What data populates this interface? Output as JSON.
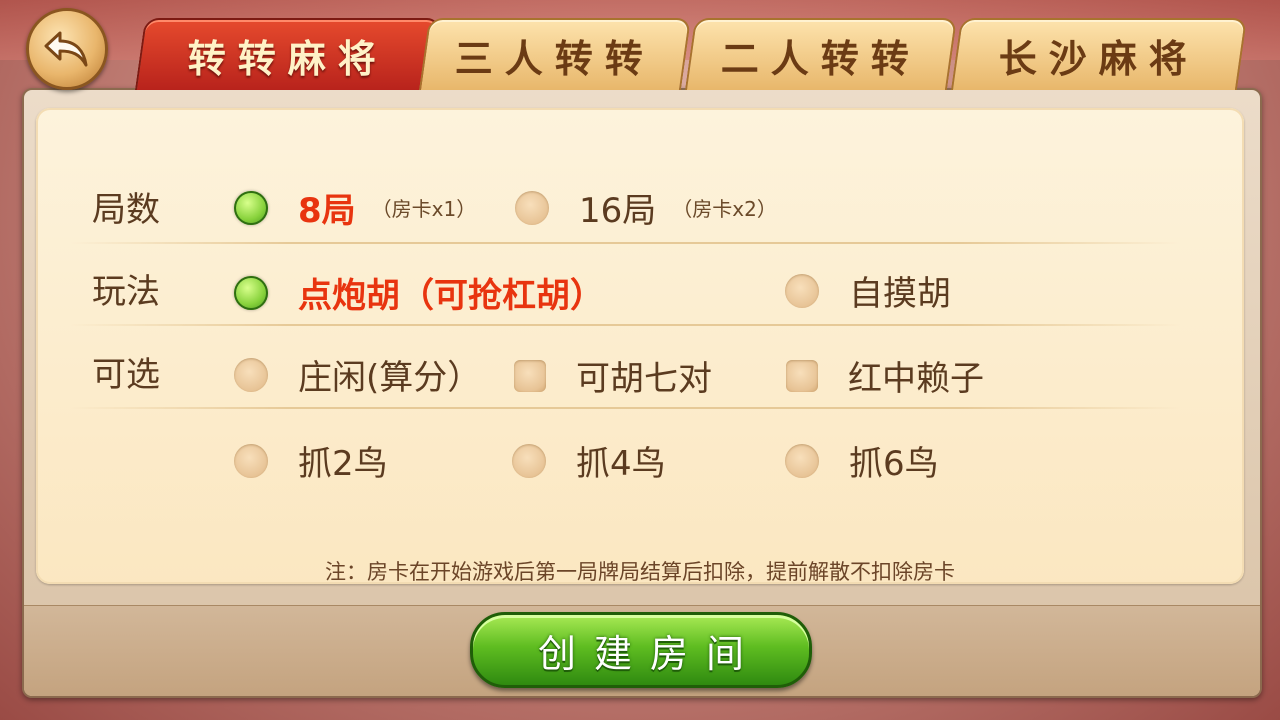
{
  "tabs": [
    {
      "label": "转转麻将",
      "active": true
    },
    {
      "label": "三人转转",
      "active": false
    },
    {
      "label": "二人转转",
      "active": false
    },
    {
      "label": "长沙麻将",
      "active": false
    }
  ],
  "rounds": {
    "label": "局数",
    "options": [
      {
        "text": "8局",
        "sub": "（房卡x1）",
        "selected": true
      },
      {
        "text": "16局",
        "sub": "（房卡x2）",
        "selected": false
      }
    ]
  },
  "play_mode": {
    "label": "玩法",
    "options": [
      {
        "text": "点炮胡（可抢杠胡）",
        "selected": true
      },
      {
        "text": "自摸胡",
        "selected": false
      }
    ]
  },
  "optional": {
    "label": "可选",
    "options": [
      {
        "text": "庄闲(算分）",
        "kind": "radio",
        "selected": false
      },
      {
        "text": "可胡七对",
        "kind": "checkbox",
        "selected": false
      },
      {
        "text": "红中赖子",
        "kind": "checkbox",
        "selected": false
      }
    ]
  },
  "birds": {
    "options": [
      {
        "text": "抓2鸟",
        "selected": false
      },
      {
        "text": "抓4鸟",
        "selected": false
      },
      {
        "text": "抓6鸟",
        "selected": false
      }
    ]
  },
  "note": "注：房卡在开始游戏后第一局牌局结算后扣除，提前解散不扣除房卡",
  "create_button": "创建房间",
  "colors": {
    "active_tab": "#c8301f",
    "selected_text": "#e8340f",
    "green_button": "#4fa81b"
  },
  "icons": {
    "back": "back-arrow-icon"
  }
}
